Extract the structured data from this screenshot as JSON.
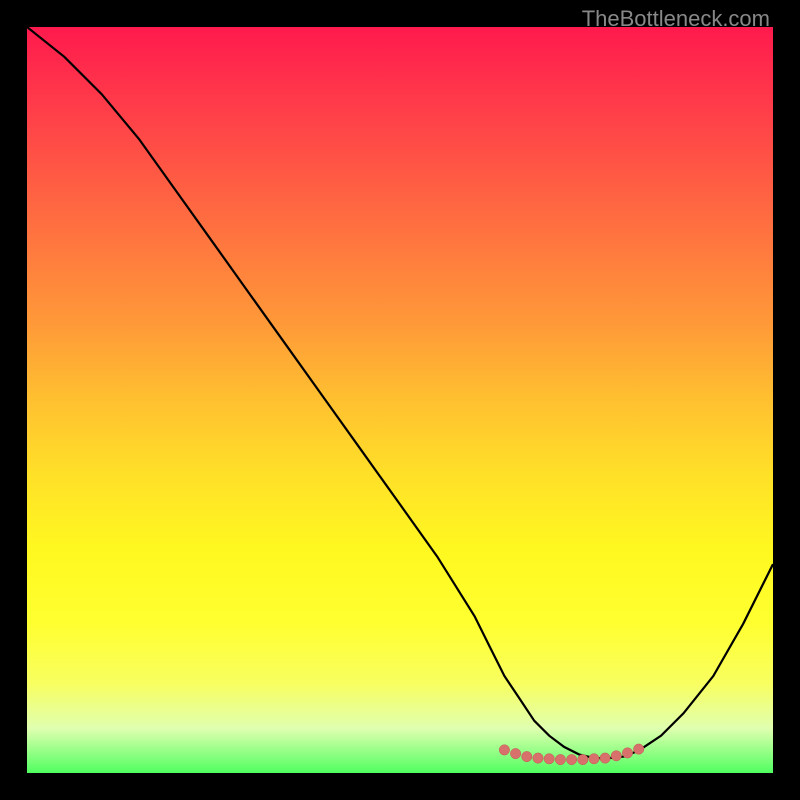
{
  "watermark": "TheBottleneck.com",
  "chart_data": {
    "type": "line",
    "title": "",
    "xlabel": "",
    "ylabel": "",
    "xlim": [
      0,
      100
    ],
    "ylim": [
      0,
      100
    ],
    "curve": {
      "x": [
        0,
        5,
        10,
        15,
        20,
        25,
        30,
        35,
        40,
        45,
        50,
        55,
        60,
        62,
        64,
        66,
        68,
        70,
        72,
        74,
        76,
        78,
        80,
        82,
        85,
        88,
        92,
        96,
        100
      ],
      "y": [
        100,
        96,
        91,
        85,
        78,
        71,
        64,
        57,
        50,
        43,
        36,
        29,
        21,
        17,
        13,
        10,
        7,
        5,
        3.5,
        2.5,
        2,
        2,
        2.2,
        3,
        5,
        8,
        13,
        20,
        28
      ]
    },
    "highlight_points": {
      "x": [
        64,
        65.5,
        67,
        68.5,
        70,
        71.5,
        73,
        74.5,
        76,
        77.5,
        79,
        80.5,
        82
      ],
      "y": [
        3.1,
        2.6,
        2.2,
        2.0,
        1.9,
        1.8,
        1.8,
        1.8,
        1.9,
        2.0,
        2.3,
        2.7,
        3.2
      ]
    },
    "gradient_colors": {
      "top": "#ff1a4d",
      "mid": "#ffe028",
      "bottom": "#50ff60"
    }
  }
}
